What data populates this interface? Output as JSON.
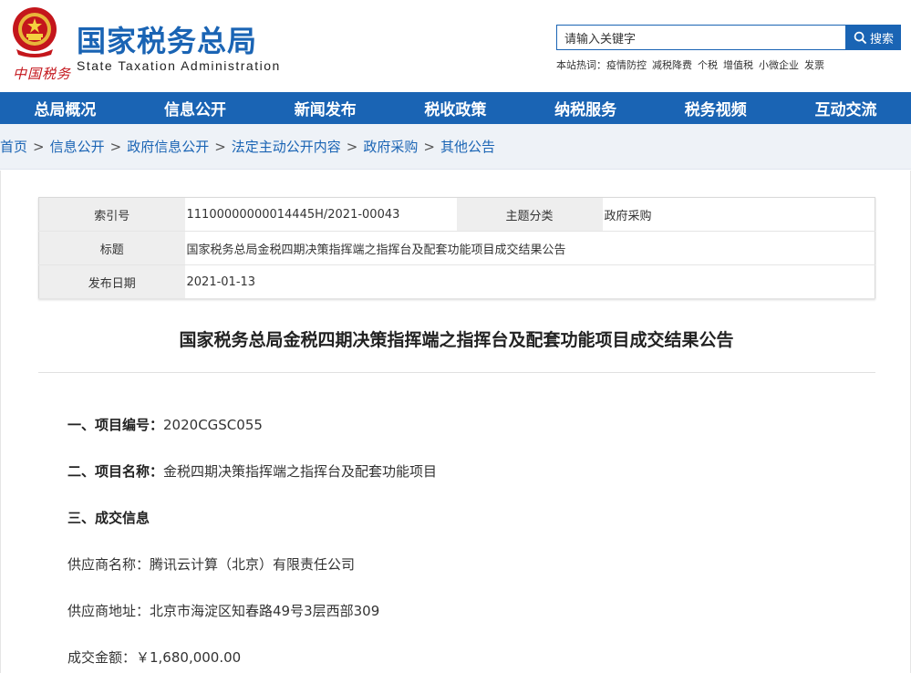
{
  "header": {
    "title": "国家税务总局",
    "subtitle": "State Taxation Administration",
    "logo_text": "中国税务",
    "search": {
      "placeholder": "请输入关键字",
      "button_label": "搜索"
    },
    "hot_label": "本站热词：",
    "hot_words": [
      "疫情防控",
      "减税降费",
      "个税",
      "增值税",
      "小微企业",
      "发票"
    ]
  },
  "nav": {
    "items": [
      "总局概况",
      "信息公开",
      "新闻发布",
      "税收政策",
      "纳税服务",
      "税务视频",
      "互动交流"
    ]
  },
  "breadcrumb": {
    "items": [
      "首页",
      "信息公开",
      "政府信息公开",
      "法定主动公开内容",
      "政府采购",
      "其他公告"
    ],
    "separator": ">"
  },
  "meta": {
    "index_label": "索引号",
    "index_value": "11100000000014445H/2021-00043",
    "category_label": "主题分类",
    "category_value": "政府采购",
    "title_label": "标题",
    "title_value": "国家税务总局金税四期决策指挥端之指挥台及配套功能项目成交结果公告",
    "date_label": "发布日期",
    "date_value": "2021-01-13"
  },
  "article": {
    "title": "国家税务总局金税四期决策指挥端之指挥台及配套功能项目成交结果公告",
    "project_no_label": "一、项目编号：",
    "project_no_value": "2020CGSC055",
    "project_name_label": "二、项目名称：",
    "project_name_value": "金税四期决策指挥端之指挥台及配套功能项目",
    "deal_info_heading": "三、成交信息",
    "supplier_name": "供应商名称：腾讯云计算（北京）有限责任公司",
    "supplier_address": "供应商地址：北京市海淀区知春路49号3层西部309",
    "deal_amount": "成交金额：￥1,680,000.00"
  },
  "colors": {
    "brand_blue": "#1a64b4",
    "seal_red": "#c4161c"
  }
}
